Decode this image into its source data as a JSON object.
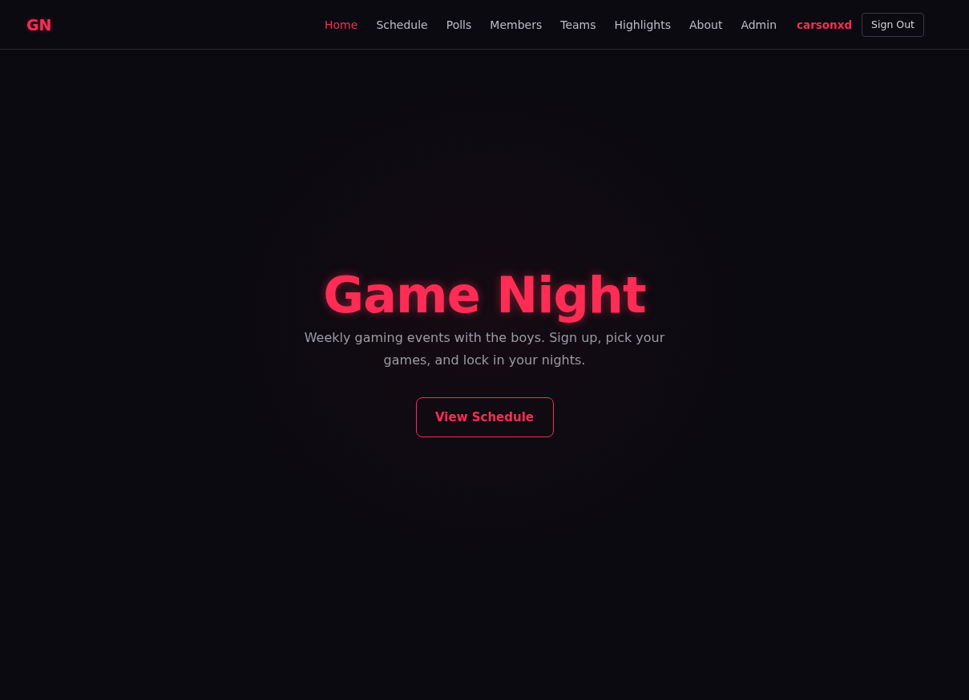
{
  "header": {
    "logo": "GN",
    "nav": [
      {
        "label": "Home",
        "selected": true
      },
      {
        "label": "Schedule",
        "selected": false
      },
      {
        "label": "Polls",
        "selected": false
      },
      {
        "label": "Members",
        "selected": false
      },
      {
        "label": "Teams",
        "selected": false
      },
      {
        "label": "Highlights",
        "selected": false
      },
      {
        "label": "About",
        "selected": false
      },
      {
        "label": "Admin",
        "selected": false
      }
    ],
    "user": "carsonxd",
    "sign_out": "Sign Out"
  },
  "hero": {
    "title": "Game Night",
    "subtitle": "Weekly gaming events with the boys. Sign up, pick your games, and lock in your nights.",
    "button": "View Schedule"
  }
}
